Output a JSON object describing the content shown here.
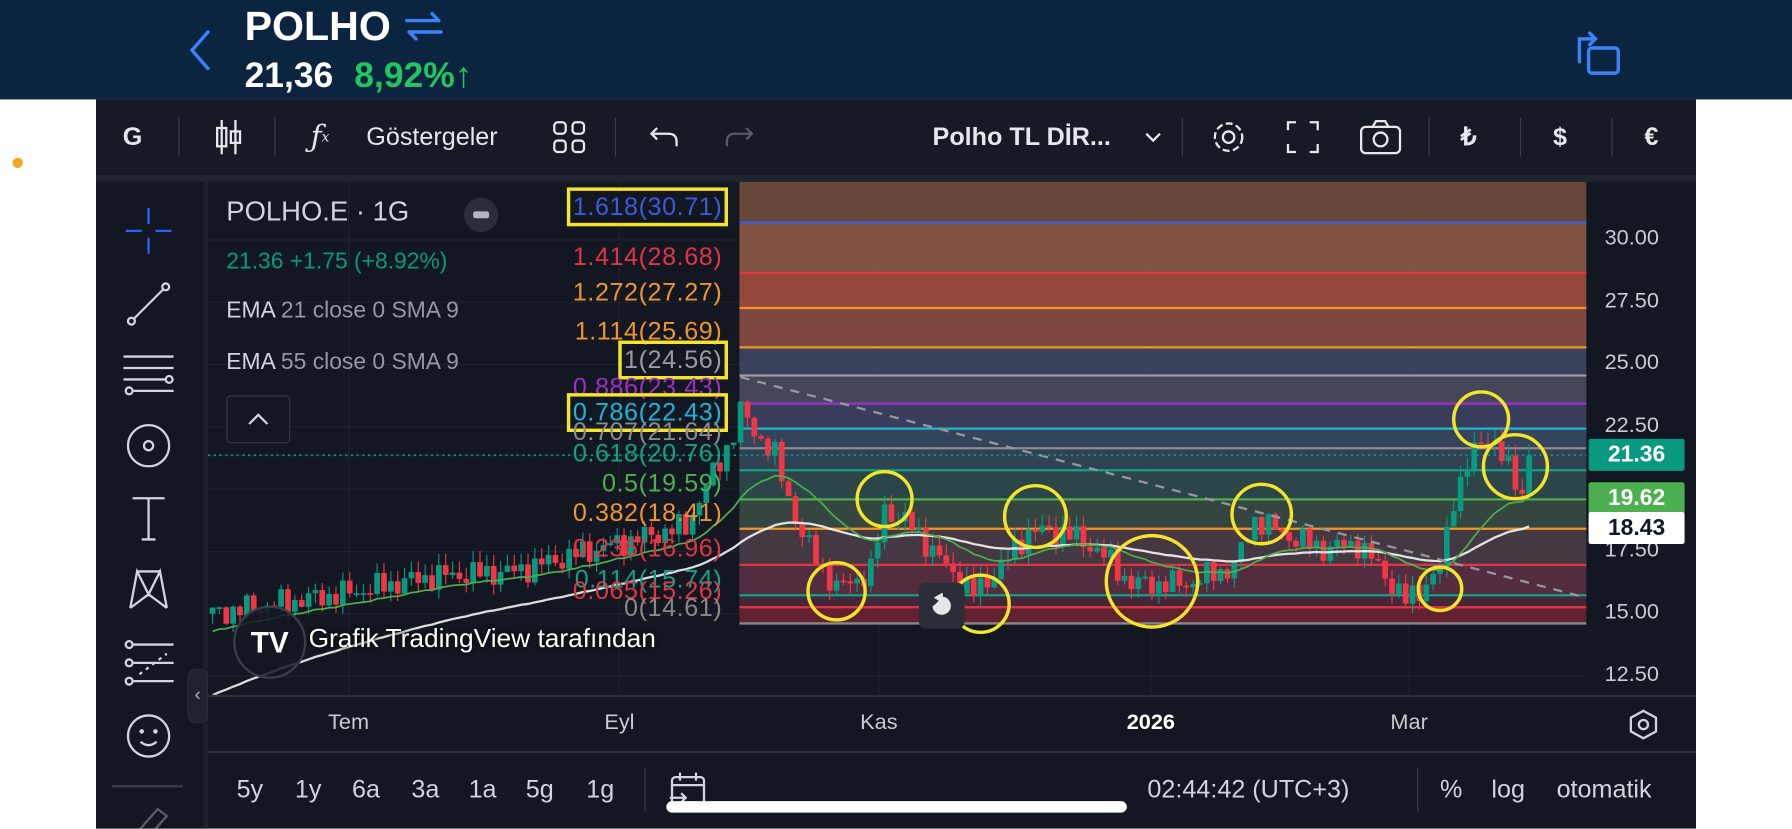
{
  "header": {
    "symbol": "POLHO",
    "price": "21,36",
    "change": "8,92%↑",
    "colors": {
      "bg": "#0b2440",
      "up": "#22c55e"
    }
  },
  "toolbar": {
    "interval": "G",
    "indicators": "Göstergeler",
    "layout_name": "Polho TL DİR...",
    "currency_try": "₺",
    "currency_usd": "$",
    "currency_eur": "€"
  },
  "legend": {
    "title": "POLHO.E · 1G",
    "quote": "21.36 +1.75 (+8.92%)",
    "ema1_name": "EMA",
    "ema1_params": "21 close 0 SMA 9",
    "ema2_name": "EMA",
    "ema2_params": "55 close 0 SMA 9"
  },
  "watermark": "Grafik TradingView tarafından",
  "price_axis": [
    "30.00",
    "27.50",
    "25.00",
    "22.50",
    "17.50",
    "15.00",
    "12.50"
  ],
  "price_tags": [
    {
      "value": "21.36",
      "bg": "#089981",
      "fg": "#ffffff"
    },
    {
      "value": "19.62",
      "bg": "#4caf50",
      "fg": "#ffffff"
    },
    {
      "value": "18.43",
      "bg": "#ffffff",
      "fg": "#131722"
    }
  ],
  "time_axis": [
    "Tem",
    "Eyl",
    "Kas",
    "2026",
    "Mar"
  ],
  "bottom": {
    "ranges": [
      "5y",
      "1y",
      "6a",
      "3a",
      "1a",
      "5g",
      "1g"
    ],
    "time": "02:44:42 (UTC+3)",
    "percent": "%",
    "log": "log",
    "auto": "otomatik"
  },
  "chart_data": {
    "type": "candlestick",
    "symbol": "POLHO.E",
    "interval": "1G",
    "ylim": [
      11.5,
      32
    ],
    "yticks": [
      12.5,
      15,
      17.5,
      20,
      22.5,
      25,
      27.5,
      30
    ],
    "xticks": [
      "Tem",
      "Eyl",
      "Kas",
      "2026",
      "Mar"
    ],
    "last_price": 21.36,
    "approx_close_path": [
      [
        0,
        15.0
      ],
      [
        19,
        15.8
      ],
      [
        32,
        16.5
      ],
      [
        44,
        16.7
      ],
      [
        56,
        17.6
      ],
      [
        69,
        18.5
      ],
      [
        76,
        22.2
      ],
      [
        77,
        23.1
      ],
      [
        82,
        21.3
      ],
      [
        86,
        18.1
      ],
      [
        91,
        16.0
      ],
      [
        96,
        16.7
      ],
      [
        98,
        19.2
      ],
      [
        102,
        18.5
      ],
      [
        107,
        16.9
      ],
      [
        111,
        15.8
      ],
      [
        116,
        17.2
      ],
      [
        119,
        18.3
      ],
      [
        124,
        18.3
      ],
      [
        129,
        17.6
      ],
      [
        134,
        16.2
      ],
      [
        142,
        16.2
      ],
      [
        149,
        16.9
      ],
      [
        152,
        18.8
      ],
      [
        157,
        18.1
      ],
      [
        162,
        17.6
      ],
      [
        167,
        17.8
      ],
      [
        170,
        16.9
      ],
      [
        174,
        15.5
      ],
      [
        179,
        16.7
      ],
      [
        181,
        19.7
      ],
      [
        184,
        21.5
      ],
      [
        186,
        22.2
      ],
      [
        189,
        20.8
      ],
      [
        191,
        19.9
      ],
      [
        192,
        21.36
      ]
    ],
    "fib_levels": [
      {
        "ratio": "1.618",
        "price": "30.71",
        "label": "1.618(30.71)",
        "color": "#3d5bd6",
        "band": "#7a5040",
        "highlight": true
      },
      {
        "ratio": "1.414",
        "price": "28.68",
        "label": "1.414(28.68)",
        "color": "#e03545",
        "band": "#8e5a48"
      },
      {
        "ratio": "1.272",
        "price": "27.27",
        "label": "1.272(27.27)",
        "color": "#f0952a",
        "band": "#a24c40"
      },
      {
        "ratio": "1.114",
        "price": "25.69",
        "label": "1.114(25.69)",
        "color": "#f0952a",
        "band": "#8a4c44"
      },
      {
        "ratio": "1",
        "price": "24.56",
        "label": "1(24.56)",
        "color": "#9a9aa0",
        "band": "#3e4662",
        "highlight": true
      },
      {
        "ratio": "0.886",
        "price": "23.43",
        "label": "0.886(23.43)",
        "color": "#9b30c8",
        "band": "#4b4b5e"
      },
      {
        "ratio": "0.786",
        "price": "22.43",
        "label": "0.786(22.43)",
        "color": "#1fb5d0",
        "band": "#3d4262",
        "highlight": true
      },
      {
        "ratio": "0.707",
        "price": "21.64",
        "label": "0.707(21.64)",
        "color": "#8a8a90",
        "band": "#394a62"
      },
      {
        "ratio": "0.618",
        "price": "20.76",
        "label": "0.618(20.76)",
        "color": "#16a085",
        "band": "#35475a"
      },
      {
        "ratio": "0.5",
        "price": "19.59",
        "label": "0.5(19.59)",
        "color": "#4caf50",
        "band": "#2f4a4c"
      },
      {
        "ratio": "0.382",
        "price": "18.41",
        "label": "0.382(18.41)",
        "color": "#f0952a",
        "band": "#3a4a42"
      },
      {
        "ratio": "0.236",
        "price": "16.96",
        "label": "0.236(16.96)",
        "color": "#e03545",
        "band": "#4a3c46"
      },
      {
        "ratio": "0.114",
        "price": "15.74",
        "label": "0.114(15.74)",
        "color": "#16a085",
        "band": "#5a3042"
      },
      {
        "ratio": "0.065",
        "price": "15.26",
        "label": "0.065(15.26)",
        "color": "#e03545",
        "band": "#4a2a3c"
      },
      {
        "ratio": "0",
        "price": "14.61",
        "label": "0(14.61)",
        "color": "#888888",
        "band": "#6a2232"
      }
    ],
    "fib_top_band": "#6c4a3c",
    "annotations": {
      "circle_color": "#f5e52a",
      "circles_at": [
        [
          91,
          15.9
        ],
        [
          98,
          19.6
        ],
        [
          112,
          15.4
        ],
        [
          120,
          18.9
        ],
        [
          137,
          16.3
        ],
        [
          153,
          19.0
        ],
        [
          185,
          22.8
        ],
        [
          190,
          20.9
        ],
        [
          179,
          16.0
        ]
      ]
    },
    "ema_colors": {
      "ema21": "#4caf50",
      "ema55": "#ffffff"
    },
    "up_color": "#089981",
    "down_color": "#f23645"
  }
}
